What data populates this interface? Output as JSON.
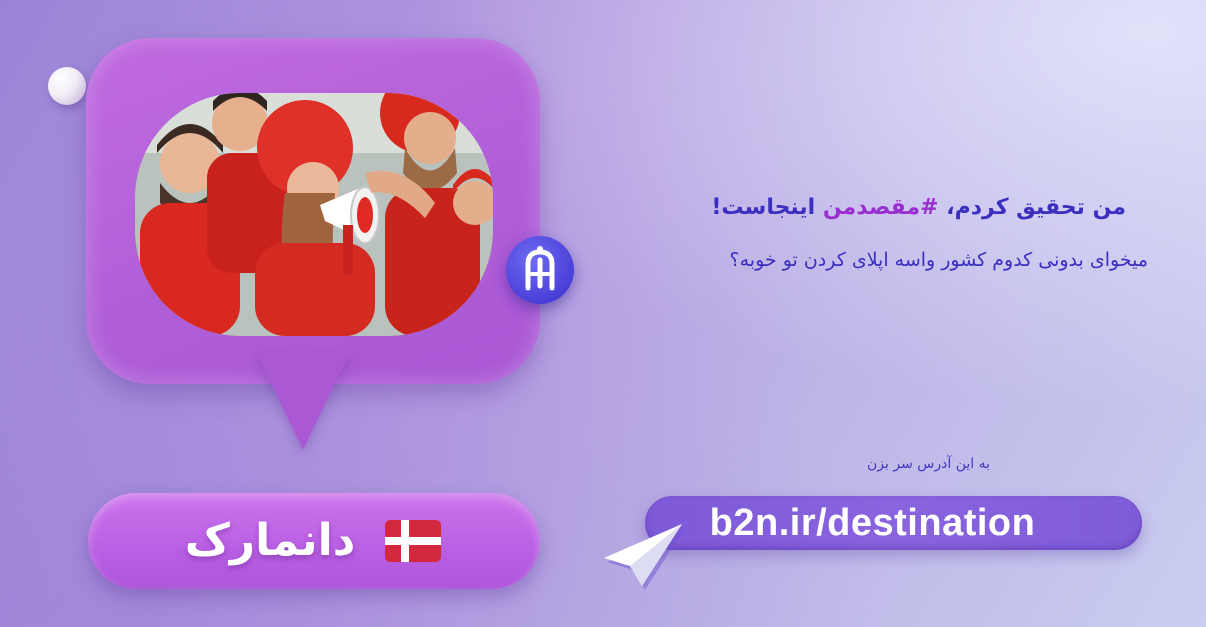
{
  "headline": {
    "prefix": "من تحقیق کردم، ",
    "hashtag": "#مقصدمن",
    "suffix": " اینجاست!"
  },
  "subline": "میخوای بدونی کدوم کشور واسه اپلای کردن تو خوبه؟",
  "visit_label": "به این آدرس سر بزن",
  "url": "b2n.ir/destination",
  "country": {
    "name": "دانمارک",
    "flag": "denmark-flag-icon"
  },
  "colors": {
    "accent": "#3a2fbf",
    "hashtag": "#9a2fd0",
    "bubble": "#b15fd9",
    "url_pill": "#8a64df",
    "flag_red": "#d4283e"
  }
}
